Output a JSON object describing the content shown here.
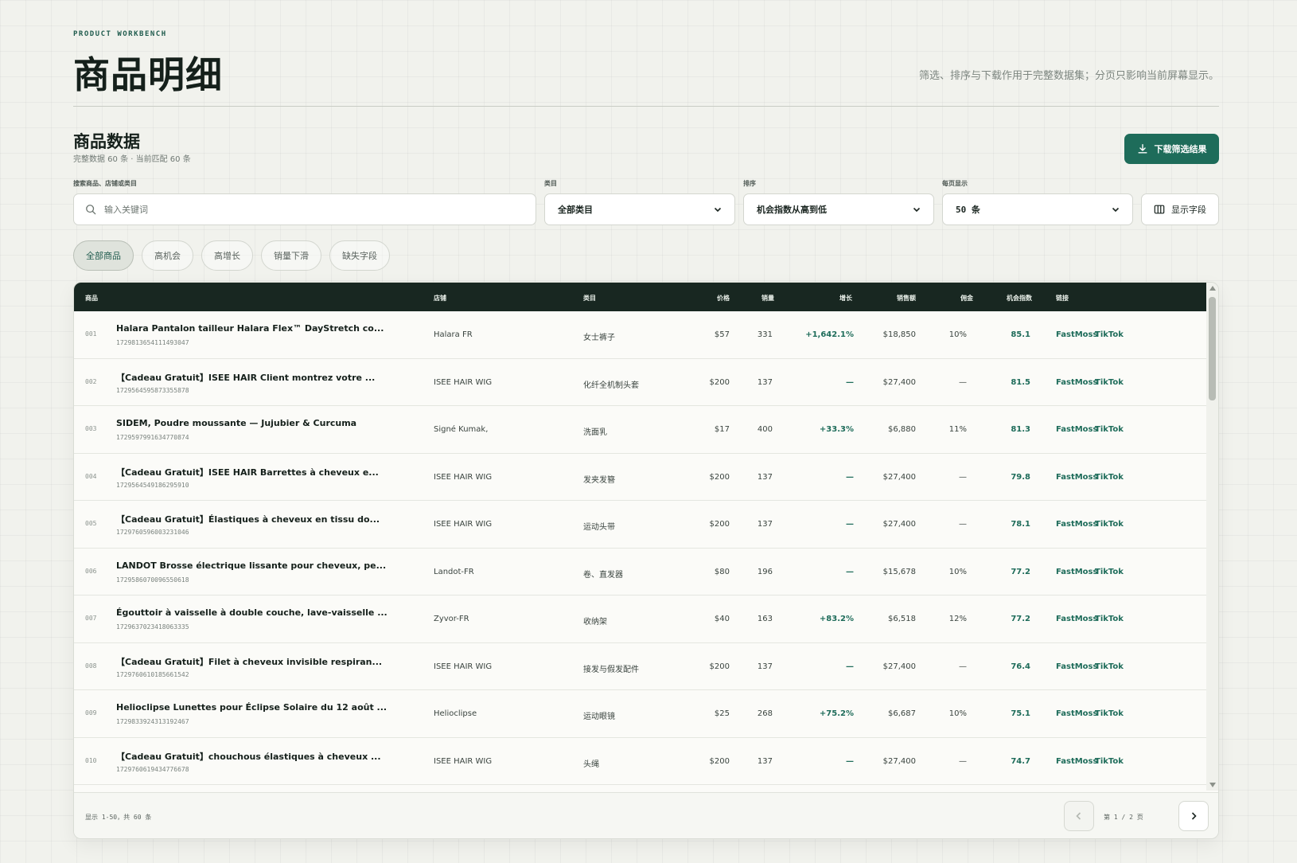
{
  "header": {
    "eyebrow": "PRODUCT WORKBENCH",
    "title": "商品明细",
    "description": "筛选、排序与下载作用于完整数据集；分页只影响当前屏幕显示。"
  },
  "section": {
    "title": "商品数据",
    "meta": "完整数据 60 条 · 当前匹配 60 条",
    "download_label": "下载筛选结果"
  },
  "filters": {
    "search_label": "搜索商品、店铺或类目",
    "search_placeholder": "输入关键词",
    "category_label": "类目",
    "category_value": "全部类目",
    "sort_label": "排序",
    "sort_value": "机会指数从高到低",
    "page_size_label": "每页显示",
    "page_size_value": "50 条",
    "columns_label": "显示字段"
  },
  "chips": [
    {
      "label": "全部商品",
      "active": true
    },
    {
      "label": "高机会",
      "active": false
    },
    {
      "label": "高增长",
      "active": false
    },
    {
      "label": "销量下滑",
      "active": false
    },
    {
      "label": "缺失字段",
      "active": false
    }
  ],
  "table": {
    "headers": {
      "product": "商品",
      "store": "店铺",
      "category": "类目",
      "price": "价格",
      "sales": "销量",
      "growth": "增长",
      "revenue": "销售额",
      "commission": "佣金",
      "score": "机会指数",
      "links": "链接"
    },
    "rows": [
      {
        "rank": "001",
        "name": "Halara Pantalon tailleur Halara Flex™ DayStretch co...",
        "id": "1729813654111493047",
        "store": "Halara FR",
        "category": "女士裤子",
        "price": "$57",
        "sales": "331",
        "growth": "+1,642.1%",
        "revenue": "$18,850",
        "commission": "10%",
        "score": "85.1",
        "link1": "FastMoss",
        "link2": "TikTok"
      },
      {
        "rank": "002",
        "name": "【Cadeau Gratuit】ISEE HAIR Client montrez votre ...",
        "id": "1729564595873355878",
        "store": "ISEE HAIR WIG",
        "category": "化纤全机制头套",
        "price": "$200",
        "sales": "137",
        "growth": "—",
        "revenue": "$27,400",
        "commission": "—",
        "score": "81.5",
        "link1": "FastMoss",
        "link2": "TikTok"
      },
      {
        "rank": "003",
        "name": "SIDEM, Poudre moussante — Jujubier & Curcuma",
        "id": "1729597991634770874",
        "store": "Signé Kumak,",
        "category": "洗面乳",
        "price": "$17",
        "sales": "400",
        "growth": "+33.3%",
        "revenue": "$6,880",
        "commission": "11%",
        "score": "81.3",
        "link1": "FastMoss",
        "link2": "TikTok"
      },
      {
        "rank": "004",
        "name": "【Cadeau Gratuit】ISEE HAIR Barrettes à cheveux e...",
        "id": "1729564549186295910",
        "store": "ISEE HAIR WIG",
        "category": "发夹发簪",
        "price": "$200",
        "sales": "137",
        "growth": "—",
        "revenue": "$27,400",
        "commission": "—",
        "score": "79.8",
        "link1": "FastMoss",
        "link2": "TikTok"
      },
      {
        "rank": "005",
        "name": "【Cadeau Gratuit】Élastiques à cheveux en tissu do...",
        "id": "1729760596003231046",
        "store": "ISEE HAIR WIG",
        "category": "运动头带",
        "price": "$200",
        "sales": "137",
        "growth": "—",
        "revenue": "$27,400",
        "commission": "—",
        "score": "78.1",
        "link1": "FastMoss",
        "link2": "TikTok"
      },
      {
        "rank": "006",
        "name": "LANDOT Brosse électrique lissante pour cheveux, pe...",
        "id": "1729586070096550618",
        "store": "Landot-FR",
        "category": "卷、直发器",
        "price": "$80",
        "sales": "196",
        "growth": "—",
        "revenue": "$15,678",
        "commission": "10%",
        "score": "77.2",
        "link1": "FastMoss",
        "link2": "TikTok"
      },
      {
        "rank": "007",
        "name": "Égouttoir à vaisselle à double couche, lave-vaisselle ...",
        "id": "1729637023418063335",
        "store": "Zyvor-FR",
        "category": "收纳架",
        "price": "$40",
        "sales": "163",
        "growth": "+83.2%",
        "revenue": "$6,518",
        "commission": "12%",
        "score": "77.2",
        "link1": "FastMoss",
        "link2": "TikTok"
      },
      {
        "rank": "008",
        "name": "【Cadeau Gratuit】Filet à cheveux invisible respiran...",
        "id": "1729760610185661542",
        "store": "ISEE HAIR WIG",
        "category": "接发与假发配件",
        "price": "$200",
        "sales": "137",
        "growth": "—",
        "revenue": "$27,400",
        "commission": "—",
        "score": "76.4",
        "link1": "FastMoss",
        "link2": "TikTok"
      },
      {
        "rank": "009",
        "name": "Helioclipse Lunettes pour Éclipse Solaire du 12 août ...",
        "id": "1729833924313192467",
        "store": "Helioclipse",
        "category": "运动眼镜",
        "price": "$25",
        "sales": "268",
        "growth": "+75.2%",
        "revenue": "$6,687",
        "commission": "10%",
        "score": "75.1",
        "link1": "FastMoss",
        "link2": "TikTok"
      },
      {
        "rank": "010",
        "name": "【Cadeau Gratuit】chouchous élastiques à cheveux ...",
        "id": "1729760619434776678",
        "store": "ISEE HAIR WIG",
        "category": "头绳",
        "price": "$200",
        "sales": "137",
        "growth": "—",
        "revenue": "$27,400",
        "commission": "—",
        "score": "74.7",
        "link1": "FastMoss",
        "link2": "TikTok"
      }
    ]
  },
  "footer": {
    "info": "显示 1-50，共 60 条",
    "page_info": "第 1 / 2 页"
  },
  "colors": {
    "accent": "#1e6c5a",
    "header_bg": "#182721"
  }
}
